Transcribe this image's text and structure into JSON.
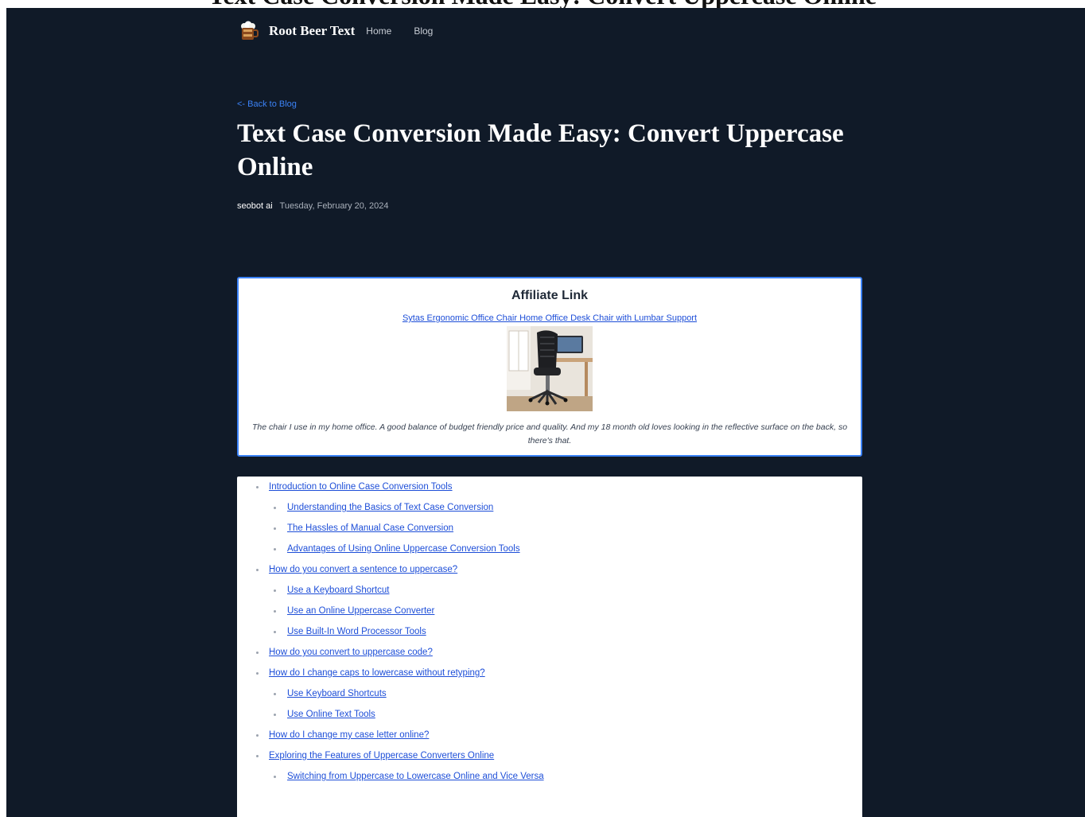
{
  "page_above": {
    "cut_heading": "Text Case Conversion Made Easy: Convert Uppercase Online"
  },
  "nav": {
    "brand": "Root Beer Text",
    "links": [
      "Home",
      "Blog"
    ],
    "logo_icon": "root-beer-mug-icon"
  },
  "post": {
    "back_link": "<- Back to Blog",
    "title": "Text Case Conversion Made Easy: Convert Uppercase Online",
    "author": "seobot ai",
    "date": "Tuesday, February 20, 2024"
  },
  "affiliate": {
    "heading": "Affiliate Link",
    "product_link": "Sytas Ergonomic Office Chair Home Office Desk Chair with Lumbar Support",
    "caption": "The chair I use in my home office. A good balance of budget friendly price and quality. And my 18 month old loves looking in the reflective surface on the back, so there's that."
  },
  "toc": {
    "items": [
      {
        "label": "Introduction to Online Case Conversion Tools",
        "children": [
          "Understanding the Basics of Text Case Conversion",
          "The Hassles of Manual Case Conversion",
          "Advantages of Using Online Uppercase Conversion Tools"
        ]
      },
      {
        "label": "How do you convert a sentence to uppercase?",
        "children": [
          "Use a Keyboard Shortcut",
          "Use an Online Uppercase Converter",
          "Use Built-In Word Processor Tools"
        ]
      },
      {
        "label": "How do you convert to uppercase code?",
        "children": []
      },
      {
        "label": "How do I change caps to lowercase without retyping?",
        "children": [
          "Use Keyboard Shortcuts",
          "Use Online Text Tools"
        ]
      },
      {
        "label": "How do I change my case letter online?",
        "children": []
      },
      {
        "label": "Exploring the Features of Uppercase Converters Online",
        "children": [
          "Switching from Uppercase to Lowercase Online and Vice Versa"
        ]
      }
    ]
  },
  "colors": {
    "page_bg": "#101a28",
    "accent": "#3b82f6",
    "link": "#1d4ed8"
  }
}
